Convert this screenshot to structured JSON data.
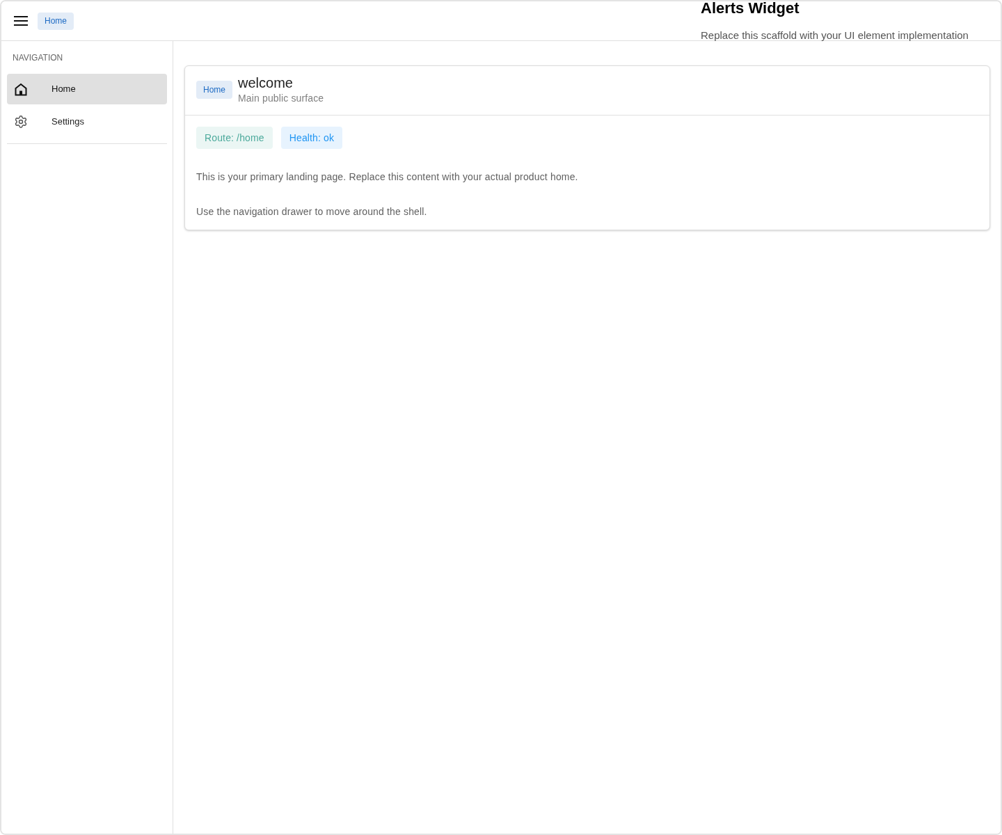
{
  "app_bar": {
    "breadcrumb": "Home"
  },
  "alerts_widget": {
    "title": "Alerts Widget",
    "description": "Replace this scaffold with your UI element implementation"
  },
  "sidebar": {
    "heading": "NAVIGATION",
    "items": [
      {
        "label": "Home",
        "selected": true
      },
      {
        "label": "Settings",
        "selected": false
      }
    ]
  },
  "card": {
    "badge": "Home",
    "title": "welcome",
    "subtitle": "Main public surface",
    "chips": [
      {
        "label": "Route: /home",
        "color": "#4daa9c"
      },
      {
        "label": "Health: ok",
        "color": "#2196f3"
      }
    ],
    "paragraphs": [
      "This is your primary landing page. Replace this content with your actual product home.",
      "Use the navigation drawer to move around the shell."
    ]
  }
}
